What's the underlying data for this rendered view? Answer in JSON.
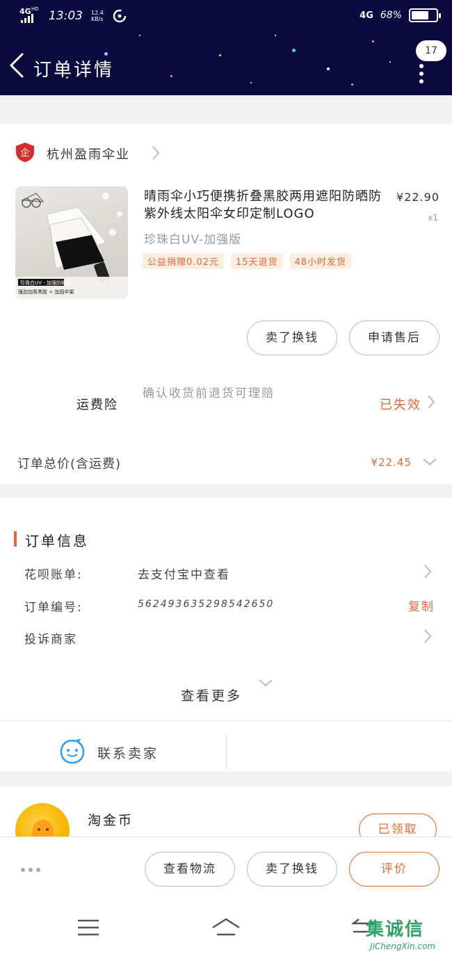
{
  "status_bar": {
    "network": "4G",
    "network_sup": "HD",
    "time": "13:03",
    "speed": "12.4",
    "speed_unit": "KB/s",
    "right_network": "4G",
    "battery": "68%"
  },
  "header": {
    "title": "订单详情",
    "message_count": "17"
  },
  "shop": {
    "logo_text": "企",
    "name": "杭州盈雨伞业"
  },
  "product": {
    "title": "晴雨伞小巧便携折叠黑胶两用遮阳防晒防紫外线太阳伞女印定制LOGO",
    "price": "¥22.90",
    "quantity": "x1",
    "sku": "珍珠白UV-加强版",
    "tags": [
      "公益捐赠0.02元",
      "15天退货",
      "48小时发货"
    ],
    "image_caption_1": "珍珠白UV - 加强防晒板",
    "image_caption_2": "强劲加厚黑胶 + 加固伞架"
  },
  "actions_top": {
    "sell_label": "卖了换钱",
    "after_sale_label": "申请售后"
  },
  "insurance": {
    "label": "运费险",
    "desc": "确认收货前退货可理赔",
    "status": "已失效"
  },
  "total": {
    "label": "订单总价(含运费)",
    "value": "¥22.45"
  },
  "order_info": {
    "title": "订单信息",
    "huabei_label": "花呗账单:",
    "huabei_value": "去支付宝中查看",
    "order_no_label": "订单编号:",
    "order_no_value": "562493635298542650",
    "copy_label": "复制",
    "complain_label": "投诉商家",
    "view_more_label": "查看更多"
  },
  "contact": {
    "label": "联系卖家"
  },
  "coins": {
    "title": "淘金币",
    "claimed_label": "已领取"
  },
  "bottom_actions": {
    "logistics_label": "查看物流",
    "sell_label": "卖了换钱",
    "review_label": "评价"
  },
  "watermark": {
    "text": "集诚信",
    "sub": "JiChengXin.com"
  },
  "colors": {
    "header_bg": "#0b0b3f",
    "accent": "#e5683a",
    "tag_bg": "#fdeee2",
    "shop_logo": "#d92d2d"
  }
}
